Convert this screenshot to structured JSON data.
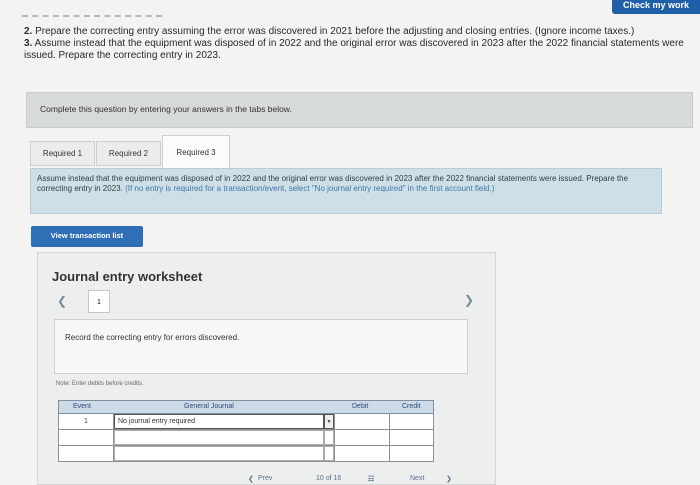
{
  "header": {
    "check_button": "Check my work"
  },
  "instructions": {
    "req2_num": "2.",
    "req2_text": "Prepare the correcting entry assuming the error was discovered in 2021 before the adjusting and closing entries. (Ignore income taxes.)",
    "req3_num": "3.",
    "req3_text": "Assume instead that the equipment was disposed of in 2022 and the original error was discovered in 2023 after the 2022 financial statements were issued. Prepare the correcting entry in 2023."
  },
  "complete_bar": "Complete this question by entering your answers in the tabs below.",
  "tabs": [
    "Required 1",
    "Required 2",
    "Required 3"
  ],
  "prompt": {
    "text": "Assume instead that the equipment was disposed of in 2022 and the original error was discovered in 2023 after the 2022 financial statements were issued. Prepare the correcting entry in 2023.",
    "hint": "(If no entry is required for a transaction/event, select \"No journal entry required\" in the first account field.)"
  },
  "view_button": "View transaction list",
  "worksheet": {
    "title": "Journal entry worksheet",
    "page": "1",
    "record_text": "Record the correcting entry for errors discovered.",
    "note": "Note: Enter debits before credits.",
    "columns": {
      "event": "Event",
      "account": "General Journal",
      "debit": "Debit",
      "credit": "Credit"
    },
    "rows": [
      {
        "event": "1",
        "account": "No journal entry required",
        "debit": "",
        "credit": ""
      },
      {
        "event": "",
        "account": "",
        "debit": "",
        "credit": ""
      },
      {
        "event": "",
        "account": "",
        "debit": "",
        "credit": ""
      }
    ]
  },
  "footer": {
    "prev": "Prev",
    "pager": "10 of 16",
    "next": "Next"
  }
}
